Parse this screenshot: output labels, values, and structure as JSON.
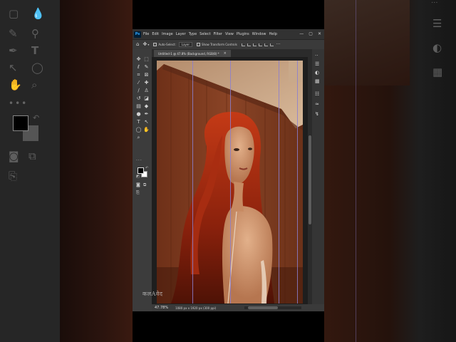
{
  "app": {
    "logo": "Ps"
  },
  "menu": [
    "File",
    "Edit",
    "Image",
    "Layer",
    "Type",
    "Select",
    "Filter",
    "View",
    "Plugins",
    "Window",
    "Help"
  ],
  "window_controls": {
    "minimize": "—",
    "maximize": "▢",
    "close": "✕"
  },
  "options_bar": {
    "home_icon": "home-icon",
    "move_icon": "move-tool-icon",
    "auto_select_label": "Auto-Select:",
    "auto_select_value": "Layer",
    "show_transform_label": "Show Transform Controls",
    "more_label": "···"
  },
  "document": {
    "tab_label": "Untitled-1 @ 47.8% (Background, RGB/8) *",
    "close_label": "×",
    "zoom": "47.78%",
    "dimensions": "1080 px x 1920 px (300 ppi)"
  },
  "toolbar": {
    "tools": [
      {
        "name": "move-tool-icon",
        "glyph": "✥"
      },
      {
        "name": "marquee-tool-icon",
        "glyph": "⬚"
      },
      {
        "name": "lasso-tool-icon",
        "glyph": "ℓ"
      },
      {
        "name": "quick-select-tool-icon",
        "glyph": "✎"
      },
      {
        "name": "crop-tool-icon",
        "glyph": "⌗"
      },
      {
        "name": "frame-tool-icon",
        "glyph": "⊠"
      },
      {
        "name": "eyedropper-tool-icon",
        "glyph": "⁄"
      },
      {
        "name": "healing-brush-icon",
        "glyph": "✚"
      },
      {
        "name": "brush-tool-icon",
        "glyph": "∕"
      },
      {
        "name": "stamp-tool-icon",
        "glyph": "♙"
      },
      {
        "name": "history-brush-icon",
        "glyph": "↺"
      },
      {
        "name": "eraser-tool-icon",
        "glyph": "◪"
      },
      {
        "name": "gradient-tool-icon",
        "glyph": "▤"
      },
      {
        "name": "blur-tool-icon",
        "glyph": "◆"
      },
      {
        "name": "dodge-tool-icon",
        "glyph": "●"
      },
      {
        "name": "pen-tool-icon",
        "glyph": "✒"
      },
      {
        "name": "type-tool-icon",
        "glyph": "T"
      },
      {
        "name": "path-select-icon",
        "glyph": "↖"
      },
      {
        "name": "shape-tool-icon",
        "glyph": "◯"
      },
      {
        "name": "hand-tool-icon",
        "glyph": "✋"
      },
      {
        "name": "zoom-tool-icon",
        "glyph": "⌕"
      }
    ],
    "more_tools": "···",
    "colors": {
      "foreground": "#000000",
      "background": "#ffffff"
    }
  },
  "watermark_text": "कलAवेद",
  "colors": {
    "accent": "#31a8ff",
    "guide": "#8b7fd0",
    "panel": "#3c3c3c",
    "canvas_bg": "#1e1e1e"
  }
}
